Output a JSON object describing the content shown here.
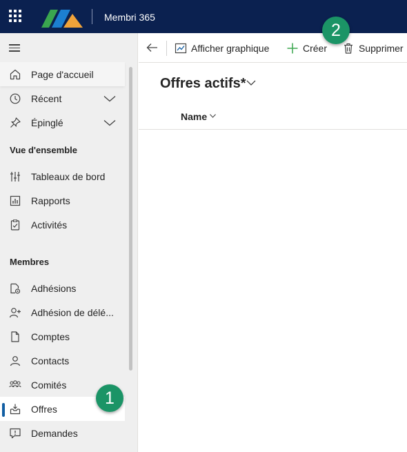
{
  "header": {
    "app_title": "Membri 365"
  },
  "logo": {
    "colors": [
      "#3aa64f",
      "#1c7fd1",
      "#f1a33a"
    ]
  },
  "sidebar": {
    "items": [
      {
        "label": "Page d'accueil",
        "icon": "home-icon"
      },
      {
        "label": "Récent",
        "icon": "clock-icon"
      },
      {
        "label": "Épinglé",
        "icon": "pin-icon"
      }
    ],
    "sections": [
      {
        "title": "Vue d'ensemble",
        "items": [
          {
            "label": "Tableaux de bord",
            "icon": "dashboard-icon"
          },
          {
            "label": "Rapports",
            "icon": "report-icon"
          },
          {
            "label": "Activités",
            "icon": "activity-icon"
          }
        ]
      },
      {
        "title": "Membres",
        "items": [
          {
            "label": "Adhésions",
            "icon": "membership-icon"
          },
          {
            "label": "Adhésion de délé...",
            "icon": "person-add-icon"
          },
          {
            "label": "Comptes",
            "icon": "document-icon"
          },
          {
            "label": "Contacts",
            "icon": "person-icon"
          },
          {
            "label": "Comités",
            "icon": "people-group-icon"
          },
          {
            "label": "Offres",
            "icon": "offer-icon",
            "selected": true
          },
          {
            "label": "Demandes",
            "icon": "chat-alert-icon"
          }
        ]
      }
    ]
  },
  "commandbar": {
    "show_chart": "Afficher graphique",
    "create": "Créer",
    "delete": "Supprimer"
  },
  "main": {
    "view_title": "Offres actifs*",
    "column_name": "Name"
  },
  "callouts": [
    "1",
    "2"
  ],
  "colors": {
    "topbar": "#0b2150",
    "accent": "#115ea3",
    "callout": "#1b9466",
    "create_plus": "#3aa64f"
  }
}
